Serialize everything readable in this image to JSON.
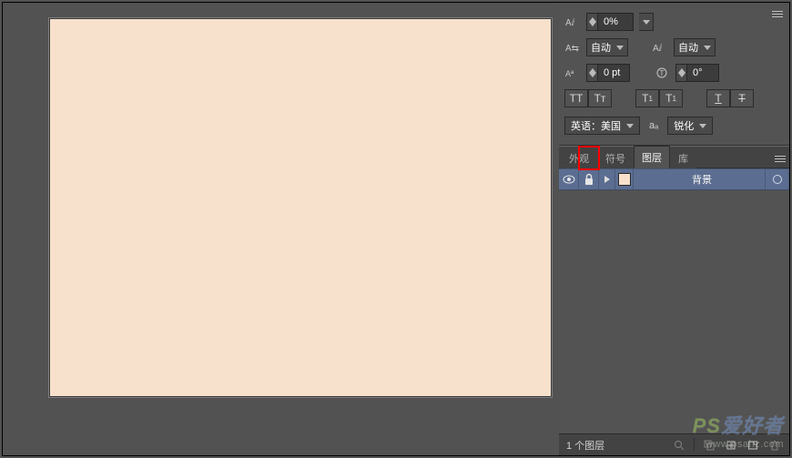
{
  "colors": {
    "bg": "#525252",
    "canvas": "#f7e1cc"
  },
  "options": {
    "tracking_value": "0%",
    "kern_auto": "自动",
    "metrics_auto": "自动",
    "baseline_shift": "0 pt",
    "rotate": "0°",
    "tt_caps": "TT",
    "tt_smallcaps": "Tᴛ",
    "tt_super": "T",
    "tt_sub": "T",
    "tt_underline": "T",
    "tt_strike": "T",
    "language": "英语：美国",
    "aa_label": "aₐ",
    "antialias": "锐化"
  },
  "tabs": {
    "appearance": "外观",
    "symbols": "符号",
    "layers": "图层",
    "library": "库"
  },
  "layer": {
    "name": "背景"
  },
  "status": {
    "text": "1 个图层"
  },
  "watermark": {
    "line1a": "PS",
    "line1b": "爱好者",
    "line2": "www.psahz.com"
  }
}
